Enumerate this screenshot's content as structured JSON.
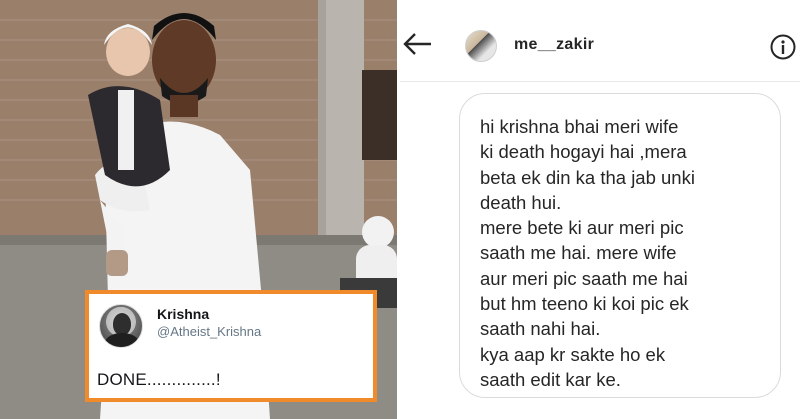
{
  "tweet": {
    "name": "Krishna",
    "handle": "@Atheist_Krishna",
    "text": "DONE..............!",
    "border_color": "#f08a2a"
  },
  "dm": {
    "username": "me__zakir",
    "back_icon": "arrow-left-icon",
    "info_icon": "info-icon",
    "message": "hi krishna bhai meri wife\nki death hogayi hai ,mera\nbeta ek din ka tha jab unki\ndeath hui.\nmere bete ki aur meri pic\nsaath me hai. mere wife\naur meri pic saath me hai\nbut hm teeno ki koi pic ek\nsaath nahi hai.\nkya aap kr sakte ho ek\nsaath  edit kar ke."
  }
}
